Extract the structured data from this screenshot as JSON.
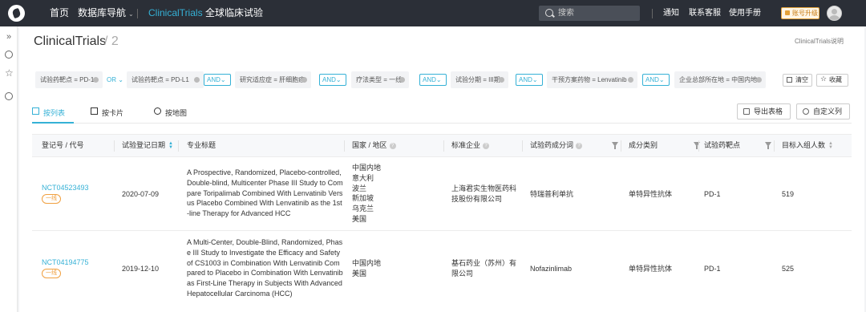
{
  "topnav": {
    "home": "首页",
    "db_nav": "数据库导航",
    "active": "ClinicalTrials",
    "global": "全球临床试验",
    "search_placeholder": "搜索",
    "notify": "通知",
    "contact": "联系客服",
    "manual": "使用手册",
    "upgrade": "账号升级"
  },
  "page": {
    "title": "ClinicalTrials",
    "count_sep": "/ 2",
    "help": "ClinicalTrials说明"
  },
  "filters": {
    "chips": [
      "试验药靶点 = PD-1",
      "试验药靶点 = PD-L1",
      "研究适应症 = 肝细胞癌",
      "疗法类型 = 一线",
      "试验分期 = III期",
      "干预方案药物 = Lenvatinib",
      "企业总部所在地 = 中国内地"
    ],
    "or_label": "OR",
    "and_label": "AND",
    "clear": "清空",
    "save": "收藏"
  },
  "tabs": {
    "list": "按列表",
    "card": "按卡片",
    "map": "按地图",
    "export": "导出表格",
    "custom_cols": "自定义列"
  },
  "table": {
    "headers": [
      "登记号 / 代号",
      "试验登记日期",
      "专业标题",
      "国家 / 地区",
      "标准企业",
      "试验药成分词",
      "成分类别",
      "试验药靶点",
      "目标入组人数"
    ],
    "rows": [
      {
        "id": "NCT04523493",
        "tag": "一线",
        "date": "2020-07-09",
        "title": "A Prospective, Randomized, Placebo-controlled, Double-blind, Multicenter Phase III Study to Compare Toripalimab Combined With Lenvatinib Versus Placebo Combined With Lenvatinib as the 1st-line Therapy for Advanced HCC",
        "countries": [
          "中国内地",
          "意大利",
          "波兰",
          "新加坡",
          "乌克兰",
          "美国"
        ],
        "company": "上海君实生物医药科技股份有限公司",
        "drug": "特瑞普利单抗",
        "category": "单特异性抗体",
        "target": "PD-1",
        "enroll": "519"
      },
      {
        "id": "NCT04194775",
        "tag": "一线",
        "date": "2019-12-10",
        "title": "A Multi-Center, Double-Blind, Randomized, Phase III Study to Investigate the Efficacy and Safety of CS1003 in Combination With Lenvatinib Compared to Placebo in Combination With Lenvatinib as First-Line Therapy in Subjects With Advanced Hepatocellular Carcinoma (HCC)",
        "countries": [
          "中国内地",
          "美国"
        ],
        "company": "基石药业（苏州）有限公司",
        "drug": "Nofazinlimab",
        "category": "单特异性抗体",
        "target": "PD-1",
        "enroll": "525"
      }
    ]
  },
  "colors": {
    "accent": "#35b1d6",
    "topbar": "#2b2f37",
    "tag": "#f0a040"
  }
}
